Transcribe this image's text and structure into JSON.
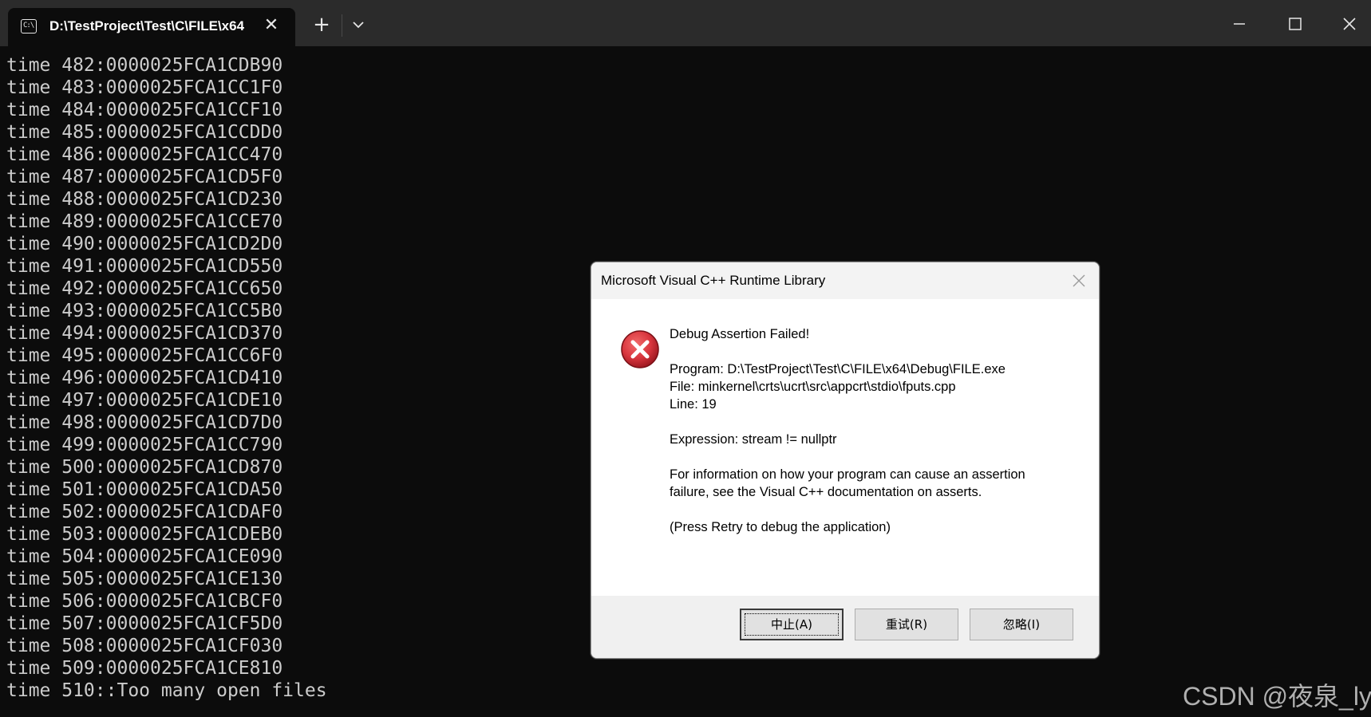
{
  "titlebar": {
    "tab_title": "D:\\TestProject\\Test\\C\\FILE\\x64",
    "tab_icon": "console-icon",
    "tab_icon_text": "C:\\",
    "new_tab_label": "+",
    "close_tab_label": "✕"
  },
  "console": {
    "lines": [
      "time 482:0000025FCA1CDB90",
      "time 483:0000025FCA1CC1F0",
      "time 484:0000025FCA1CCF10",
      "time 485:0000025FCA1CCDD0",
      "time 486:0000025FCA1CC470",
      "time 487:0000025FCA1CD5F0",
      "time 488:0000025FCA1CD230",
      "time 489:0000025FCA1CCE70",
      "time 490:0000025FCA1CD2D0",
      "time 491:0000025FCA1CD550",
      "time 492:0000025FCA1CC650",
      "time 493:0000025FCA1CC5B0",
      "time 494:0000025FCA1CD370",
      "time 495:0000025FCA1CC6F0",
      "time 496:0000025FCA1CD410",
      "time 497:0000025FCA1CDE10",
      "time 498:0000025FCA1CD7D0",
      "time 499:0000025FCA1CC790",
      "time 500:0000025FCA1CD870",
      "time 501:0000025FCA1CDA50",
      "time 502:0000025FCA1CDAF0",
      "time 503:0000025FCA1CDEB0",
      "time 504:0000025FCA1CE090",
      "time 505:0000025FCA1CE130",
      "time 506:0000025FCA1CBCF0",
      "time 507:0000025FCA1CF5D0",
      "time 508:0000025FCA1CF030",
      "time 509:0000025FCA1CE810",
      "time 510::Too many open files"
    ]
  },
  "dialog": {
    "title": "Microsoft Visual C++ Runtime Library",
    "heading": "Debug Assertion Failed!",
    "program": "Program: D:\\TestProject\\Test\\C\\FILE\\x64\\Debug\\FILE.exe",
    "file": "File: minkernel\\crts\\ucrt\\src\\appcrt\\stdio\\fputs.cpp",
    "line": "Line: 19",
    "expression": "Expression: stream != nullptr",
    "info_line1": "For information on how your program can cause an assertion",
    "info_line2": "failure, see the Visual C++ documentation on asserts.",
    "press_retry": "(Press Retry to debug the application)",
    "icon": "error-icon",
    "buttons": {
      "abort": "中止(A)",
      "retry": "重试(R)",
      "ignore": "忽略(I)"
    }
  },
  "watermark": "CSDN @夜泉_ly",
  "colors": {
    "console_bg": "#0c0c0c",
    "console_text": "#cccccc",
    "titlebar_bg": "#2b2b2b",
    "error_red": "#d9363e"
  }
}
